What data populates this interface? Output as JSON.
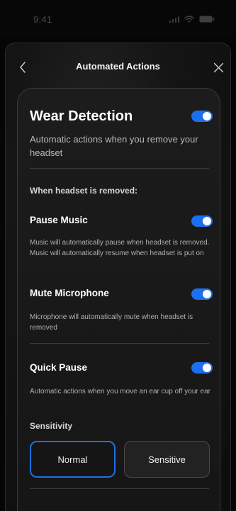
{
  "status_bar": {
    "time": "9:41"
  },
  "nav": {
    "title": "Automated Actions"
  },
  "wear_detection": {
    "title": "Wear Detection",
    "subtitle": "Automatic actions when you remove your headset",
    "enabled": true
  },
  "removed_section": {
    "label": "When headset is removed:"
  },
  "pause_music": {
    "title": "Pause Music",
    "description": "Music will automatically pause when headset is removed. Music will automatically resume when headset is put on",
    "enabled": true
  },
  "mute_microphone": {
    "title": "Mute Microphone",
    "description": "Microphone will automatically mute when headset is removed",
    "enabled": true
  },
  "quick_pause": {
    "title": "Quick Pause",
    "description": "Automatic actions when you move an ear cup off your ear",
    "enabled": true
  },
  "sensitivity": {
    "label": "Sensitivity",
    "options": [
      "Normal",
      "Sensitive"
    ],
    "selected": "Normal"
  },
  "colors": {
    "accent": "#1e6ef0",
    "background": "#050505",
    "card": "#1c1c1c"
  },
  "icons": {
    "back": "chevron-left-icon",
    "close": "close-icon",
    "signal": "signal-icon",
    "wifi": "wifi-icon",
    "battery": "battery-icon"
  }
}
